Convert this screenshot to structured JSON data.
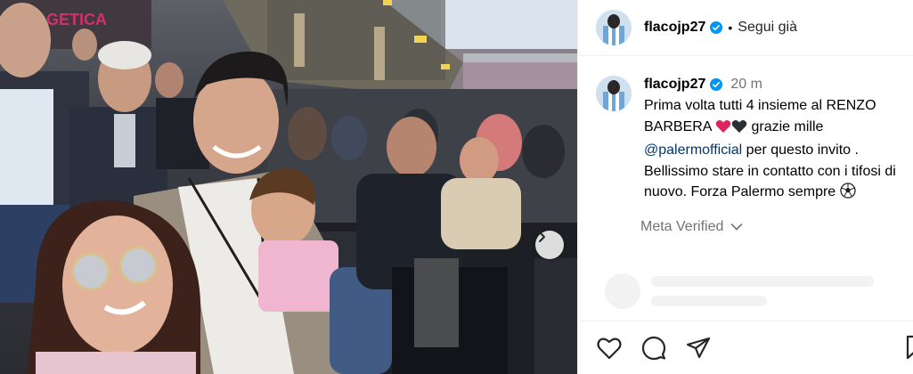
{
  "post": {
    "author": "flacojp27",
    "follow_status": "Segui già",
    "separator": "•",
    "caption": {
      "author": "flacojp27",
      "time": "20 m",
      "line1": "Prima volta tutti 4 insieme al RENZO BARBERA",
      "line1_after": "grazie mille",
      "mention": "@palermofficial",
      "line2": "per questo invito . Bellissimo stare in contatto con i tifosi di nuovo. Forza Palermo sempre",
      "emoji_hearts": [
        "red-heart",
        "black-heart"
      ],
      "emoji_end": "soccer-ball"
    },
    "meta_verified": "Meta Verified",
    "background_text": "GETICA",
    "colors": {
      "verified_badge": "#0095f6",
      "mention": "#00376b",
      "secondary_text": "#737373",
      "divider": "#efefef",
      "heart_red": "#e0245e",
      "jacket_plaid": "#9a8e80",
      "stadium_sky": "#dbe3ef"
    },
    "icons": [
      "verified-badge-icon",
      "chevron-down-icon",
      "heart-icon",
      "comment-icon",
      "share-icon",
      "bookmark-icon",
      "chevron-right-icon"
    ]
  }
}
